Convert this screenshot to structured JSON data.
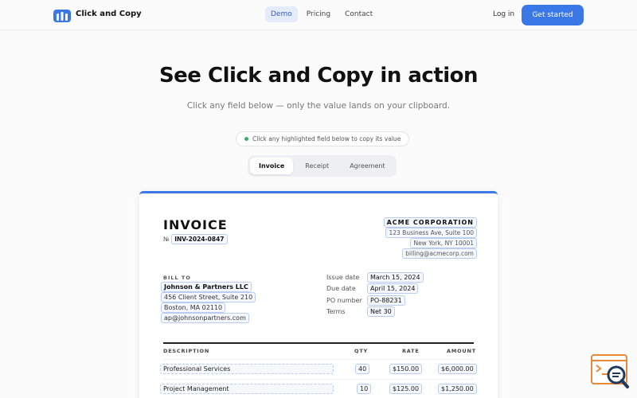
{
  "header": {
    "brand": "Click and Copy",
    "nav": [
      "Demo",
      "Pricing",
      "Contact"
    ],
    "login": "Log in",
    "cta": "Get started"
  },
  "hero": {
    "title": "See Click and Copy in action",
    "subtitle": "Click any field below — only the value lands on your clipboard.",
    "hint": "Click any highlighted field below to copy its value"
  },
  "tabs": [
    "Invoice",
    "Receipt",
    "Agreement"
  ],
  "invoice": {
    "title": "INVOICE",
    "number_prefix": "№",
    "number": "INV-2024-0847",
    "company": {
      "name": "ACME CORPORATION",
      "address1": "123 Business Ave, Suite 100",
      "address2": "New York, NY 10001",
      "email": "billing@acmecorp.com"
    },
    "bill_to_label": "BILL TO",
    "bill_to": {
      "name": "Johnson & Partners LLC",
      "address1": "456 Client Street, Suite 210",
      "address2": "Boston, MA 02110",
      "email": "ap@johnsonpartners.com"
    },
    "meta": [
      {
        "label": "Issue date",
        "value": "March 15, 2024"
      },
      {
        "label": "Due date",
        "value": "April 15, 2024"
      },
      {
        "label": "PO number",
        "value": "PO-88231"
      },
      {
        "label": "Terms",
        "value": "Net 30"
      }
    ],
    "columns": [
      "DESCRIPTION",
      "QTY",
      "RATE",
      "AMOUNT"
    ],
    "items": [
      {
        "description": "Professional Services",
        "qty": "40",
        "rate": "$150.00",
        "amount": "$6,000.00"
      },
      {
        "description": "Project Management",
        "qty": "10",
        "rate": "$125.00",
        "amount": "$1,250.00"
      }
    ]
  },
  "colors": {
    "accent": "#3b78e7",
    "field_border": "#b9cdf0",
    "status_dot": "#2fb463",
    "widget_orange": "#e8883a"
  },
  "icons": {
    "logo": "brand-logo-icon",
    "widget": "copy-search-widget-icon"
  }
}
